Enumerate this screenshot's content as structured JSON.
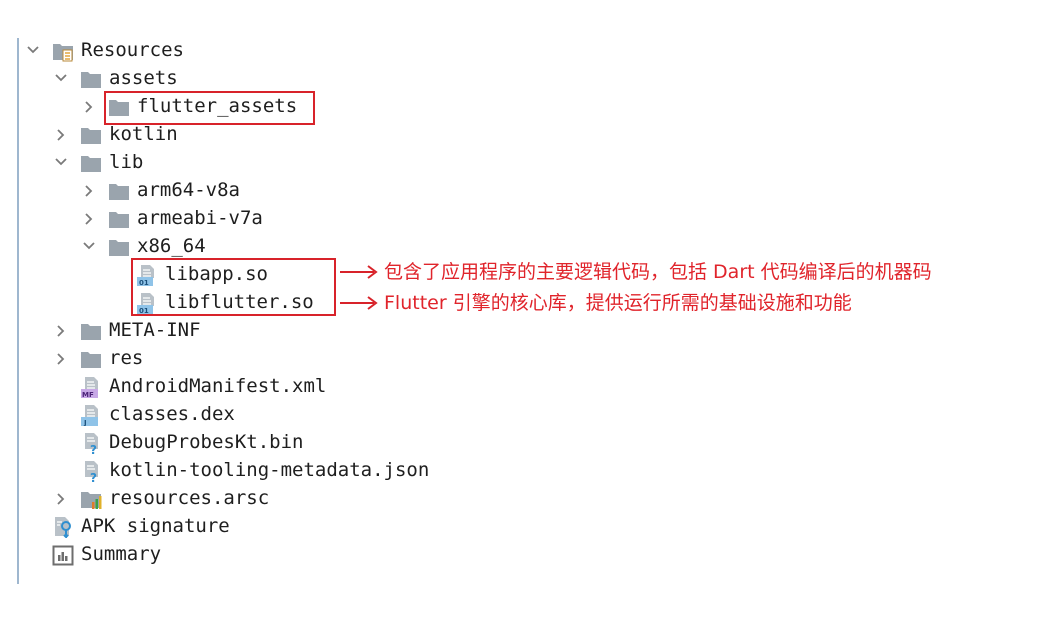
{
  "tree": {
    "resources": "Resources",
    "assets": "assets",
    "flutter_assets": "flutter_assets",
    "kotlin": "kotlin",
    "lib": "lib",
    "arm64": "arm64-v8a",
    "armeabi": "armeabi-v7a",
    "x86": "x86_64",
    "libapp": "libapp.so",
    "libflutter": "libflutter.so",
    "meta_inf": "META-INF",
    "res": "res",
    "manifest": "AndroidManifest.xml",
    "classes": "classes.dex",
    "debugprobes": "DebugProbesKt.bin",
    "kotlin_tooling": "kotlin-tooling-metadata.json",
    "resources_arsc": "resources.arsc",
    "apk_signature": "APK signature",
    "summary": "Summary"
  },
  "icon_badges": {
    "so": "01",
    "manifest": "MF",
    "dex": "J"
  },
  "annotations": {
    "libapp_note": "包含了应用程序的主要逻辑代码，包括 Dart 代码编译后的机器码",
    "libflutter_note": "Flutter 引擎的核心库，提供运行所需的基础设施和功能"
  },
  "colors": {
    "highlight": "#d8232a",
    "annotation_text": "#e0242b",
    "folder": "#9aa4ad"
  }
}
